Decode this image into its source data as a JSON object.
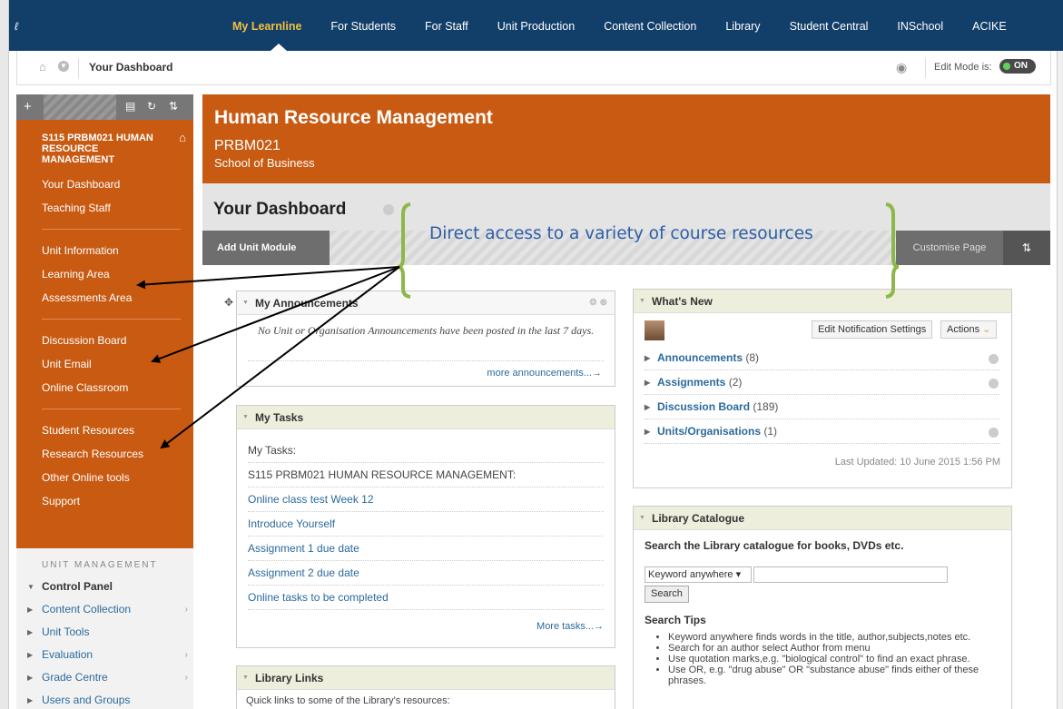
{
  "topnav": {
    "items": [
      "My Learnline",
      "For Students",
      "For Staff",
      "Unit Production",
      "Content Collection",
      "Library",
      "Student Central",
      "INSchool",
      "ACIKE"
    ]
  },
  "breadcrumb": {
    "title": "Your Dashboard",
    "edit_mode_label": "Edit Mode is:",
    "edit_mode_state": "ON"
  },
  "sidebar": {
    "unit_name": "S115 PRBM021 HUMAN RESOURCE MANAGEMENT",
    "group1": [
      "Your Dashboard",
      "Teaching Staff"
    ],
    "group2": [
      "Unit Information",
      "Learning Area",
      "Assessments Area"
    ],
    "group3": [
      "Discussion Board",
      "Unit Email",
      "Online Classroom"
    ],
    "group4": [
      "Student Resources",
      "Research Resources",
      "Other Online tools",
      "Support"
    ],
    "management_heading": "UNIT MANAGEMENT",
    "control_panel": "Control Panel",
    "management_items": [
      "Content Collection",
      "Unit Tools",
      "Evaluation",
      "Grade Centre",
      "Users and Groups"
    ]
  },
  "course": {
    "title": "Human Resource Management",
    "code": "PRBM021",
    "school": "School of Business"
  },
  "dashboard": {
    "title": "Your Dashboard",
    "add_module": "Add Unit Module",
    "customise": "Customise Page",
    "callout": "Direct access to a variety of course resources"
  },
  "announcements": {
    "title": "My Announcements",
    "message": "No Unit or Organisation Announcements have been posted in the last 7 days.",
    "more": "more announcements...→"
  },
  "tasks": {
    "title": "My Tasks",
    "label": "My Tasks:",
    "unit": "S115 PRBM021 HUMAN RESOURCE MANAGEMENT:",
    "items": [
      "Online class test Week 12",
      "Introduce Yourself",
      "Assignment 1 due date",
      "Assignment 2 due date",
      "Online tasks to be completed"
    ],
    "more": "More tasks...→"
  },
  "whats_new": {
    "title": "What's New",
    "edit_button": "Edit Notification Settings",
    "actions_button": "Actions",
    "rows": [
      {
        "label": "Announcements",
        "count": "(8)"
      },
      {
        "label": "Assignments",
        "count": "(2)"
      },
      {
        "label": "Discussion Board",
        "count": "(189)"
      },
      {
        "label": "Units/Organisations",
        "count": "(1)"
      }
    ],
    "updated": "Last Updated: 10 June 2015 1:56 PM"
  },
  "library": {
    "title": "Library Catalogue",
    "intro": "Search the Library catalogue for books, DVDs etc.",
    "select": "Keyword anywhere",
    "search_button": "Search",
    "tips_title": "Search Tips",
    "tips": [
      "Keyword anywhere finds words in the title, author,subjects,notes etc.",
      "Search for an author select Author from menu",
      "Use quotation marks,e.g. \"biological control\" to find an exact phrase.",
      "Use OR, e.g. \"drug abuse\" OR \"substance abuse\" finds either of these phrases."
    ]
  },
  "library_links": {
    "title": "Library Links",
    "text": "Quick links to some of the Library's resources:"
  },
  "colors": {
    "nav_bg": "#123e6a",
    "accent_orange": "#c85a12",
    "active_nav": "#f3c13a",
    "callout": "#2c5ea8",
    "bracket": "#8cb84a"
  }
}
